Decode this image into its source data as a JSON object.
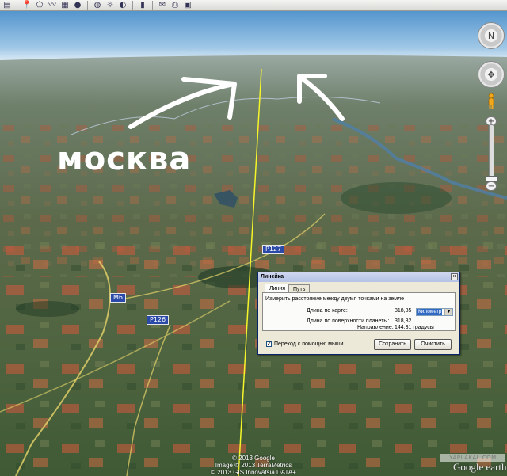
{
  "toolbar": {
    "icons": [
      "sidebar-icon",
      "placemark-icon",
      "polygon-icon",
      "path-icon",
      "overlay-icon",
      "tour-icon",
      "earth-icon",
      "sun-icon",
      "planets-icon",
      "ruler-icon",
      "email-icon",
      "print-icon",
      "save-image-icon"
    ]
  },
  "annotation": {
    "city_label": "москва"
  },
  "roads": {
    "m6": "M6",
    "p126": "P126",
    "p127": "P127"
  },
  "nav": {
    "look_symbol": "N",
    "move_symbol": "✥",
    "zoom_in": "+",
    "zoom_out": "−"
  },
  "ruler_dialog": {
    "title": "Линейка",
    "close": "×",
    "tabs": [
      "Линия",
      "Путь"
    ],
    "description": "Измерить расстояние между двумя точками на земле",
    "map_length_label": "Длина по карте:",
    "map_length_value": "318,85",
    "unit": "Километр",
    "surface_length_label": "Длина по поверхности планеты:",
    "surface_length_value": "318,82",
    "heading_label": "Направление:",
    "heading_value": "144,31 градусы",
    "mouse_nav_label": "Переход с помощью мыши",
    "mouse_nav_checked": "✓",
    "save_label": "Сохранить",
    "clear_label": "Очистить"
  },
  "credits": {
    "line1": "© 2013 Google",
    "line2": "Image © 2013 TerraMetrics",
    "line3": "© 2013 GIS Innovatsia  DATA+",
    "logo": "Google earth",
    "watermark": "YAPLAKAL.COM"
  }
}
